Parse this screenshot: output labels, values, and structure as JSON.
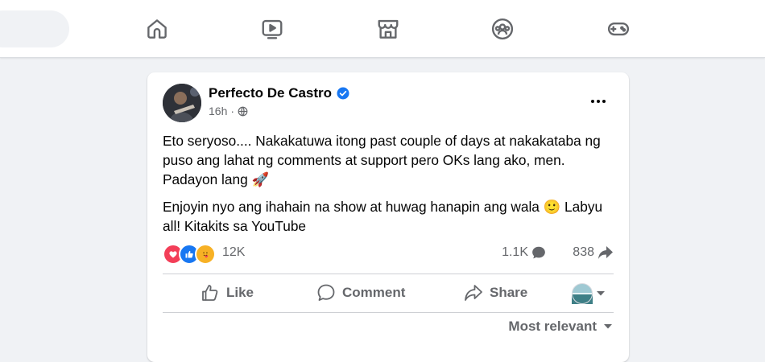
{
  "post": {
    "author": "Perfecto De Castro",
    "time": "16h",
    "paragraph1": "Eto seryoso.... Nakakatuwa itong past couple of days at nakakataba ng puso ang lahat ng comments at support pero OKs lang ako, men. Padayon lang 🚀",
    "paragraph2": "Enjoyin nyo ang ihahain na show at huwag hanapin ang wala 🙂 Labyu all! Kitakits sa YouTube",
    "reaction_count": "12K",
    "comment_count": "1.1K",
    "share_count": "838"
  },
  "actions": {
    "like": "Like",
    "comment": "Comment",
    "share": "Share"
  },
  "sort_label": "Most relevant",
  "colors": {
    "accent": "#1877f2",
    "love": "#f33e58",
    "care": "#f7b125",
    "muted": "#65676b"
  },
  "icons": [
    "home-icon",
    "watch-icon",
    "marketplace-icon",
    "groups-icon",
    "gaming-icon"
  ]
}
